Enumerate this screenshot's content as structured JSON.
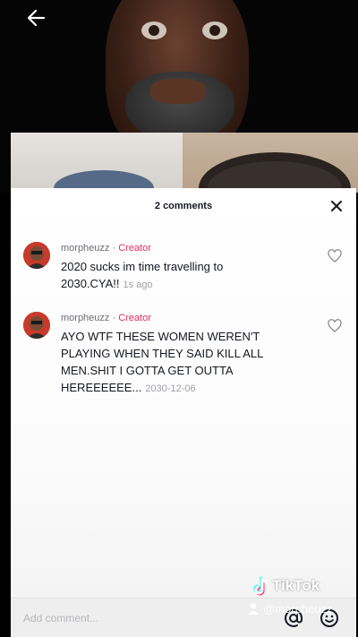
{
  "sheet": {
    "title": "2 comments"
  },
  "comments": [
    {
      "username": "morpheuzz",
      "separator": " · ",
      "creator_label": "Creator",
      "text": "2020 sucks im time travelling to 2030.CYA!!",
      "time": "1s ago"
    },
    {
      "username": "morpheuzz",
      "separator": " · ",
      "creator_label": "Creator",
      "text": "AYO WTF THESE WOMEN WEREN'T PLAYING WHEN THEY SAID KILL ALL MEN.SHIT I GOTTA GET OUTTA HEREEEEEE...",
      "time": "2030-12-06"
    }
  ],
  "composer": {
    "placeholder": "Add comment...",
    "mention_icon": "at-icon",
    "emoji_icon": "emoji-icon"
  },
  "watermark": {
    "brand": "TikTok",
    "handle": "@morpheuzz"
  },
  "colors": {
    "creator": "#e0305a",
    "text": "#161823",
    "muted": "#a0a2a8"
  }
}
